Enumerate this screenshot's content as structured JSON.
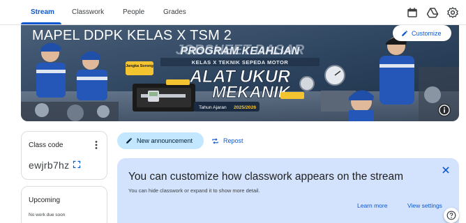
{
  "nav": {
    "tabs": [
      {
        "label": "Stream",
        "active": true
      },
      {
        "label": "Classwork",
        "active": false
      },
      {
        "label": "People",
        "active": false
      },
      {
        "label": "Grades",
        "active": false
      }
    ],
    "icons": [
      "calendar-icon",
      "drive-icon",
      "settings-icon"
    ]
  },
  "banner": {
    "class_title": "MAPEL DDPK KELAS X TSM 2",
    "customize_label": "Customize",
    "artwork": {
      "line1": "JOBSHEET DASAR",
      "line2": "PROGRAM KEAHLIAN",
      "line3": "KELAS X TEKNIK SEPEDA MOTOR",
      "line4": "ALAT UKUR",
      "line5": "MEKANIK",
      "tag": "Jangka Sorong",
      "year_prefix": "Tahun Ajaran",
      "year_value": "2025/2026"
    }
  },
  "class_code": {
    "title": "Class code",
    "value": "ewjrb7hz"
  },
  "upcoming": {
    "title": "Upcoming",
    "status": "No work due soon"
  },
  "stream": {
    "new_announcement_label": "New announcement",
    "repost_label": "Repost"
  },
  "info_panel": {
    "title": "You can customize how classwork appears on the stream",
    "subtitle": "You can hide classwork or expand it to show more detail.",
    "learn_more_label": "Learn more",
    "view_settings_label": "View settings"
  },
  "colors": {
    "accent": "#0b57d0",
    "chip_bg": "#c2e7ff",
    "panel_bg": "#d3e3fd"
  }
}
